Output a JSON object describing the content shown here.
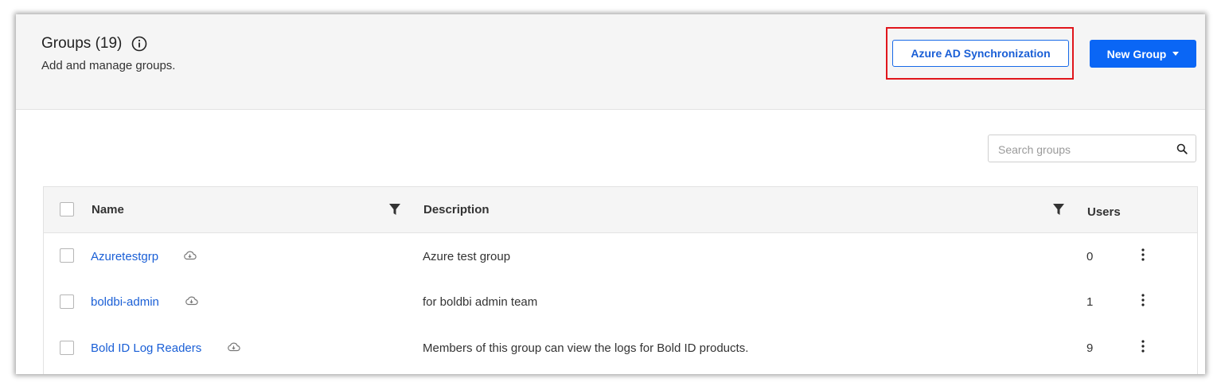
{
  "header": {
    "title": "Groups (19)",
    "subtitle": "Add and manage groups.",
    "info_icon": "info-circle-icon"
  },
  "toolbar": {
    "azure_sync_label": "Azure AD Synchronization",
    "new_group_label": "New Group",
    "highlight_color": "#e0161c",
    "accent_color": "#0a66f5"
  },
  "search": {
    "placeholder": "Search groups",
    "value": ""
  },
  "table": {
    "columns": {
      "name": "Name",
      "description": "Description",
      "users": "Users"
    },
    "rows": [
      {
        "name": "Azuretestgrp",
        "description": "Azure test group",
        "users": "0",
        "icon": "cloud-sync-icon"
      },
      {
        "name": "boldbi-admin",
        "description": "for boldbi admin team",
        "users": "1",
        "icon": "cloud-sync-icon"
      },
      {
        "name": "Bold ID Log Readers",
        "description": "Members of this group can view the logs for Bold ID products.",
        "users": "9",
        "icon": "cloud-sync-icon"
      }
    ]
  }
}
